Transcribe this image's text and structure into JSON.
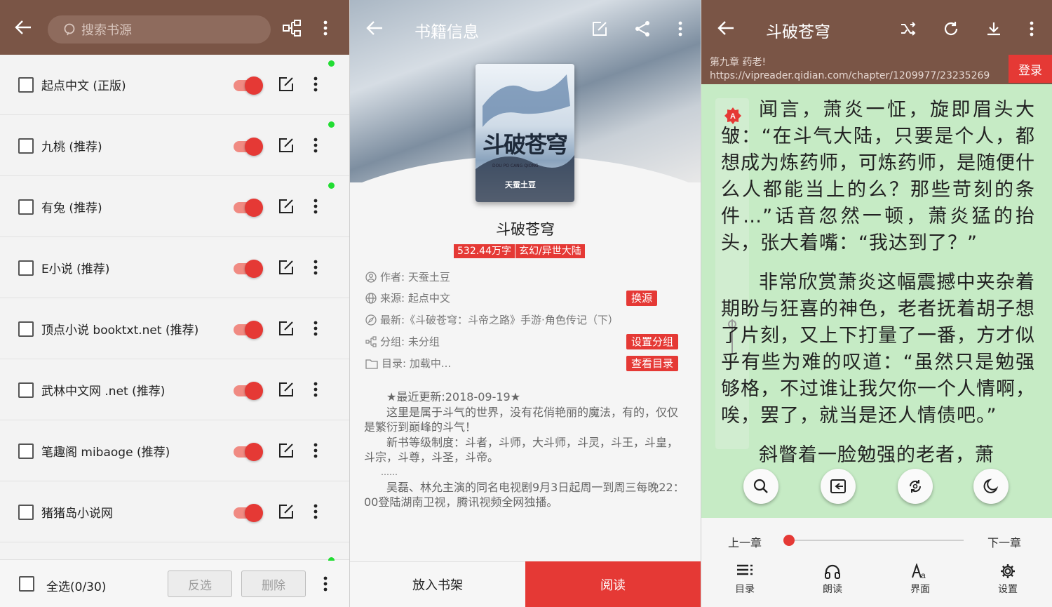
{
  "panel1": {
    "search_placeholder": "搜索书源",
    "sources": [
      {
        "label": "起点中文 (正版)",
        "dot": true
      },
      {
        "label": "九桃 (推荐)",
        "dot": true
      },
      {
        "label": "有兔 (推荐)",
        "dot": true
      },
      {
        "label": "E小说 (推荐)",
        "dot": false
      },
      {
        "label": "顶点小说 booktxt.net (推荐)",
        "dot": false
      },
      {
        "label": "武林中文网 .net (推荐)",
        "dot": false
      },
      {
        "label": "笔趣阁 mibaoge (推荐)",
        "dot": false
      },
      {
        "label": "猪猪岛小说网",
        "dot": false
      }
    ],
    "footer": {
      "select_all": "全选(0/30)",
      "invert": "反选",
      "delete": "删除"
    }
  },
  "panel2": {
    "title": "书籍信息",
    "cover": {
      "title": "斗破苍穹",
      "subtitle": "DOU PO CANG QIONG",
      "author": "天蚕土豆"
    },
    "book_name": "斗破苍穹",
    "tags": [
      "532.44万字",
      "玄幻/异世大陆"
    ],
    "author": "作者: 天蚕土豆",
    "source": "来源: 起点中文",
    "latest": "最新:《斗破苍穹：斗帝之路》手游·角色传记（下）",
    "group": "分组: 未分组",
    "catalog": "目录: 加载中...",
    "change_source": "换源",
    "set_group": "设置分组",
    "view_catalog": "查看目录",
    "desc_line1": "★最近更新:2018-09-19★",
    "desc_line2": "这里是属于斗气的世界，没有花俏艳丽的魔法，有的，仅仅是繁衍到巅峰的斗气！",
    "desc_line3": "新书等级制度：斗者，斗师，大斗师，斗灵，斗王，斗皇，斗宗，斗尊，斗圣，斗帝。",
    "desc_line4": "……",
    "desc_line5": "吴磊、林允主演的同名电视剧9月3日起周一到周三每晚22：00登陆湖南卫视，腾讯视频全网独播。",
    "add_shelf": "放入书架",
    "read": "阅读"
  },
  "panel3": {
    "title": "斗破苍穹",
    "chapter": "第九章 药老!",
    "url": "https://vipreader.qidian.com/chapter/1209977/23235269",
    "login": "登录",
    "para1": "闻言，萧炎一怔，旋即眉头大皱：“在斗气大陆，只要是个人，都想成为炼药师，可炼药师，是随便什么人都能当上的么？那些苛刻的条件…”话音忽然一顿，萧炎猛的抬头，张大着嘴：“我达到了？”",
    "para2": "非常欣赏萧炎这幅震撼中夹杂着期盼与狂喜的神色，老者抚着胡子想了片刻，又上下打量了一番，方才似乎有些为难的叹道：“虽然只是勉强够格，不过谁让我欠你一个人情啊，唉，罢了，就当是还人情债吧。”",
    "para3": "斜瞥着一脸勉强的老者，萧",
    "prev": "上一章",
    "next": "下一章",
    "progress": 0,
    "tabs": [
      "目录",
      "朗读",
      "界面",
      "设置"
    ]
  },
  "colors": {
    "primary": "#7a5546",
    "accent": "#e53935",
    "reader_bg": "#c6ebc5"
  }
}
